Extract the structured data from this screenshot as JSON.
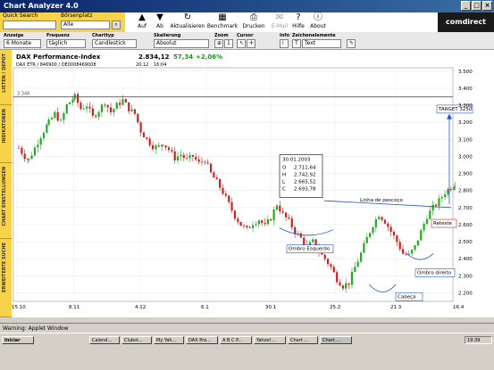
{
  "window": {
    "title": "Chart Analyzer 4.0",
    "buttons": [
      "_",
      "□",
      "×"
    ]
  },
  "toolbar": {
    "quick_search_label": "Quick Search",
    "quick_search_value": "",
    "exchange_label": "Börsenplatz",
    "exchange_value": "Alle",
    "tools": [
      {
        "name": "up",
        "label": "Auf",
        "icon": "arrow-up"
      },
      {
        "name": "down",
        "label": "Ab",
        "icon": "arrow-down"
      },
      {
        "name": "refresh",
        "label": "Aktualisieren",
        "icon": "refresh"
      },
      {
        "name": "benchmark",
        "label": "Benchmark",
        "icon": "chart"
      },
      {
        "name": "print",
        "label": "Drucken",
        "icon": "printer"
      },
      {
        "name": "email",
        "label": "E-Mail",
        "icon": "mail"
      },
      {
        "name": "help",
        "label": "Hilfe",
        "icon": "question"
      },
      {
        "name": "about",
        "label": "About",
        "icon": "info"
      }
    ],
    "logo": "comdirect"
  },
  "options": {
    "display_label": "Anzeige",
    "display_value": "6 Monate",
    "frequency_label": "Frequenz",
    "frequency_value": "täglich",
    "charttype_label": "Charttyp",
    "charttype_value": "Candlestick",
    "scaling_label": "Skalierung",
    "scaling_value": "Absolut",
    "zoom_label": "Zoom",
    "cursor_label": "Cursor",
    "info_label": "Info",
    "drawing_label": "Zeichenelemente",
    "drawing_value": "Text"
  },
  "sidebar": [
    "LISTEN / DEPOT",
    "INDIKATOREN",
    "CHART EINSTELLUNGEN",
    "ERWEITERTE SUCHE"
  ],
  "quote": {
    "name": "DAX Performance-Index",
    "price": "2.834,12",
    "change": "57,34",
    "change_pct": "+2,06%",
    "ids": "DAX ETR / 846900 / DE0008469008",
    "date": "20.12",
    "time": "16:04"
  },
  "chart_data": {
    "type": "candlestick",
    "x_ticks": [
      "15.10",
      "8.11",
      "4.12",
      "6.1",
      "30.1",
      "25.2",
      "21.3",
      "16.4"
    ],
    "y_ticks": [
      3500,
      3400,
      3300,
      3200,
      3100,
      3000,
      2900,
      2800,
      2700,
      2600,
      2500,
      2400,
      2300,
      2200
    ],
    "ylim": [
      2150,
      3520
    ],
    "resistance_level": 3349,
    "resistance_label": "3.349",
    "neckline_label": "Linha de pescoço",
    "target_label": "TARGET 3250",
    "target_value": 3250,
    "annotations": [
      "Ombro Esquerdo",
      "Cabeça",
      "Ombro direito",
      "Reteste"
    ],
    "tooltip": {
      "date": "30.01.2003",
      "o": "2.711,64",
      "h": "2.742,92",
      "l": "2.665,52",
      "c": "2.693,78"
    },
    "colors": {
      "up": "#22aa22",
      "down": "#cc2222",
      "grid": "#dddddd"
    }
  },
  "status": "Warning: Applet Window",
  "taskbar": {
    "start": "Iniciar",
    "items": [
      "Calend...",
      "Clubst...",
      "My Yah...",
      "DAX Pro...",
      "A B C P...",
      "Yahoo!...",
      "Chart ...",
      "Chart ..."
    ],
    "clock": "19:39"
  }
}
